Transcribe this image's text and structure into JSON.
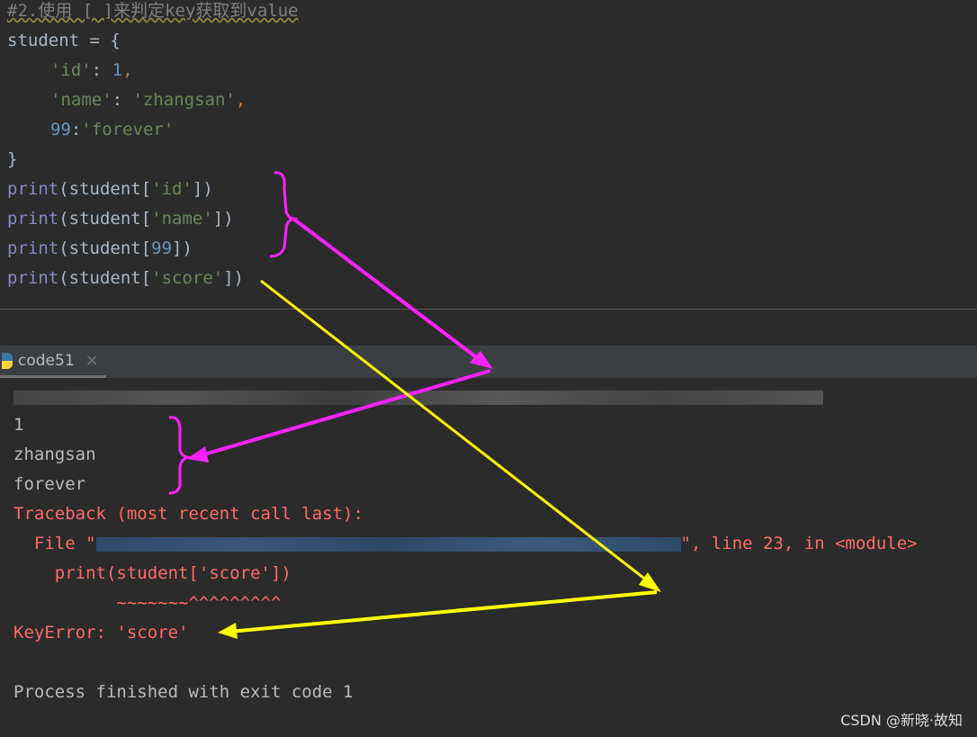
{
  "editor": {
    "comment": "#2.使用 [ ]来判定key获取到value",
    "lines": {
      "l1a": "student",
      "l1b": " = {",
      "id_key": "'id'",
      "colon": ": ",
      "id_val": "1",
      "comma": ",",
      "name_key": "'name'",
      "name_val": "'zhangsan'",
      "k99": "99",
      "c2": ":",
      "forever": "'forever'",
      "close": "}",
      "print": "print",
      "p_open": "(student[",
      "p_close": "])",
      "s_id": "'id'",
      "s_name": "'name'",
      "n99": "99",
      "s_score": "'score'"
    }
  },
  "run_tab": {
    "label": "code51",
    "icon": "python-icon",
    "close": "×"
  },
  "console": {
    "out1": "1",
    "out2": "zhangsan",
    "out3": "forever",
    "tb": "Traceback (most recent call last):",
    "file_pre": "  File \"",
    "file_post": "\", line 23, in <module>",
    "code": "    print(student['score'])",
    "marker": "          ~~~~~~~^^^^^^^^^",
    "error": "KeyError: 'score'",
    "exit": "Process finished with exit code 1"
  },
  "watermark": "CSDN @新晓·故知",
  "colors": {
    "annotation_magenta": "#ff22ff",
    "annotation_yellow": "#ffff00"
  }
}
